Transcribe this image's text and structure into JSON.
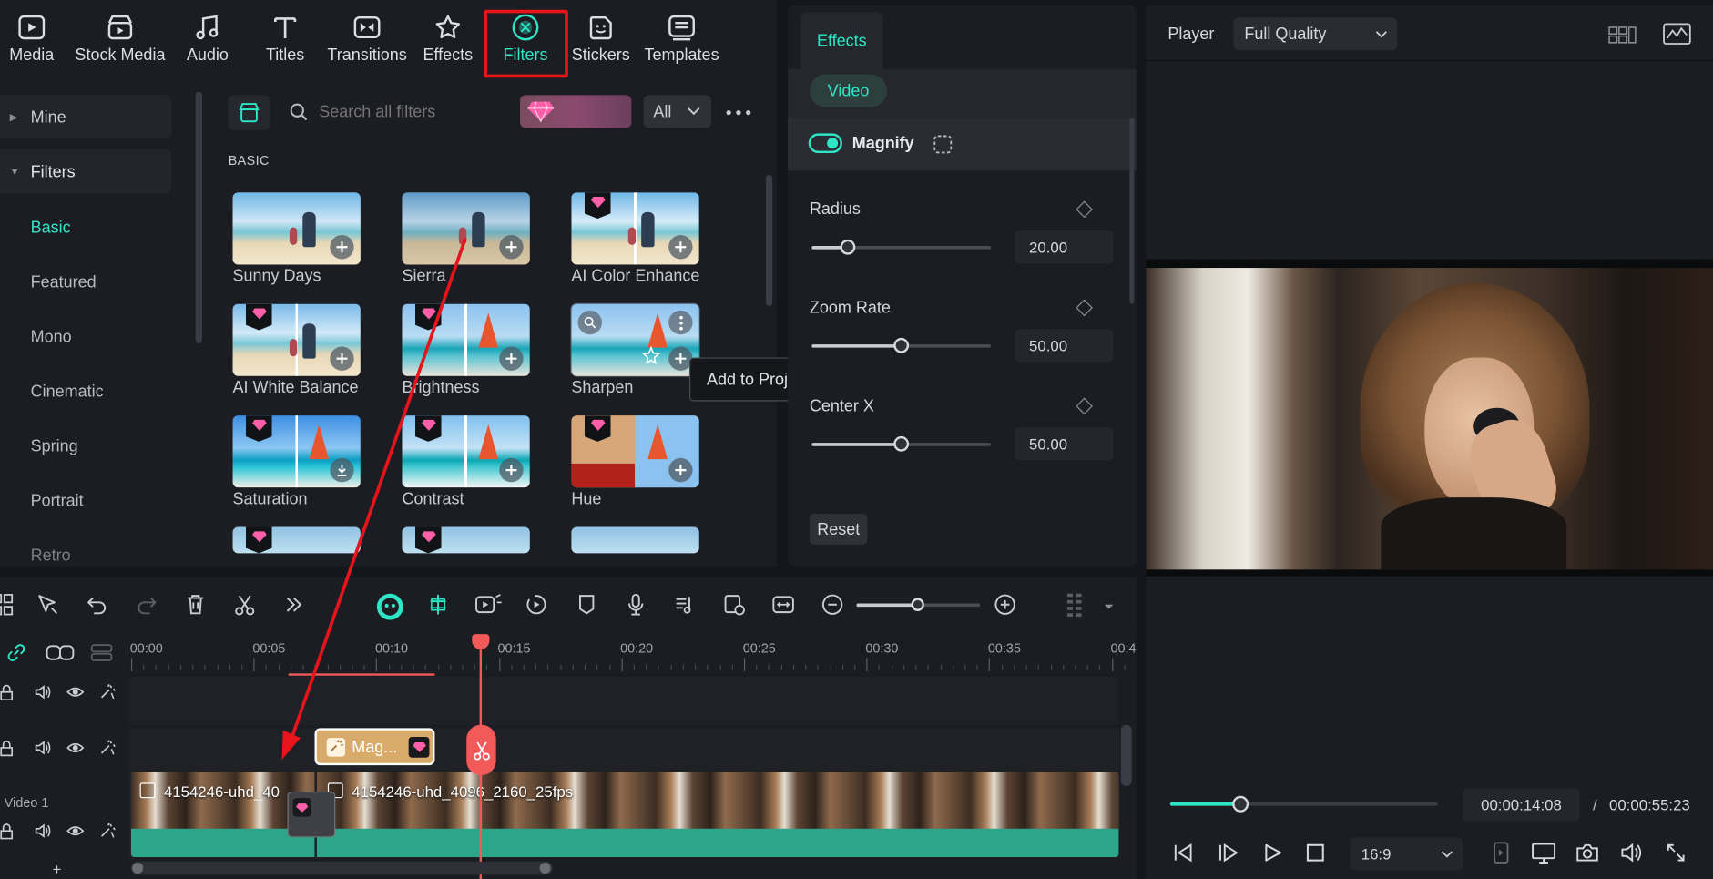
{
  "nav": {
    "items": [
      {
        "label": "Media",
        "icon": "media-icon"
      },
      {
        "label": "Stock Media",
        "icon": "stock-media-icon"
      },
      {
        "label": "Audio",
        "icon": "audio-icon"
      },
      {
        "label": "Titles",
        "icon": "titles-icon"
      },
      {
        "label": "Transitions",
        "icon": "transitions-icon"
      },
      {
        "label": "Effects",
        "icon": "effects-icon"
      },
      {
        "label": "Filters",
        "icon": "filters-icon",
        "active": true
      },
      {
        "label": "Stickers",
        "icon": "stickers-icon"
      },
      {
        "label": "Templates",
        "icon": "templates-icon"
      }
    ]
  },
  "sidebar": {
    "mine": "Mine",
    "filters": "Filters",
    "items": [
      "Basic",
      "Featured",
      "Mono",
      "Cinematic",
      "Spring",
      "Portrait",
      "Retro"
    ],
    "selected": "Basic"
  },
  "search": {
    "placeholder": "Search all filters",
    "dropdown": "All"
  },
  "section": {
    "title": "BASIC"
  },
  "filters": [
    {
      "name": "Sunny Days",
      "premium": false
    },
    {
      "name": "Sierra",
      "premium": false
    },
    {
      "name": "AI Color Enhance",
      "premium": true
    },
    {
      "name": "AI White Balance",
      "premium": true
    },
    {
      "name": "Brightness",
      "premium": true
    },
    {
      "name": "Sharpen",
      "premium": false
    },
    {
      "name": "Saturation",
      "premium": true
    },
    {
      "name": "Contrast",
      "premium": true
    },
    {
      "name": "Hue",
      "premium": true
    }
  ],
  "tooltip": "Add to Project",
  "effects": {
    "tab": "Effects",
    "subtab": "Video",
    "effect_name": "Magnify",
    "enabled": true,
    "params": [
      {
        "label": "Radius",
        "value": "20.00",
        "fraction": 0.2
      },
      {
        "label": "Zoom Rate",
        "value": "50.00",
        "fraction": 0.5
      },
      {
        "label": "Center X",
        "value": "50.00",
        "fraction": 0.5
      }
    ],
    "reset": "Reset"
  },
  "player": {
    "label": "Player",
    "quality": "Full Quality",
    "current": "00:00:14:08",
    "separator": "/",
    "total": "00:00:55:23",
    "aspect": "16:9",
    "progress": 0.26
  },
  "timeline": {
    "ruler": [
      "00:00",
      "00:05",
      "00:10",
      "00:15",
      "00:20",
      "00:25",
      "00:30",
      "00:35",
      "00:4"
    ],
    "effect_clip": "Mag...",
    "clip1": "4154246-uhd_40",
    "clip2": "4154246-uhd_4096_2160_25fps",
    "track_label": "Video 1"
  },
  "colors": {
    "accent": "#2ee6c5",
    "highlight": "#e8141b",
    "playhead": "#f25a5a"
  }
}
